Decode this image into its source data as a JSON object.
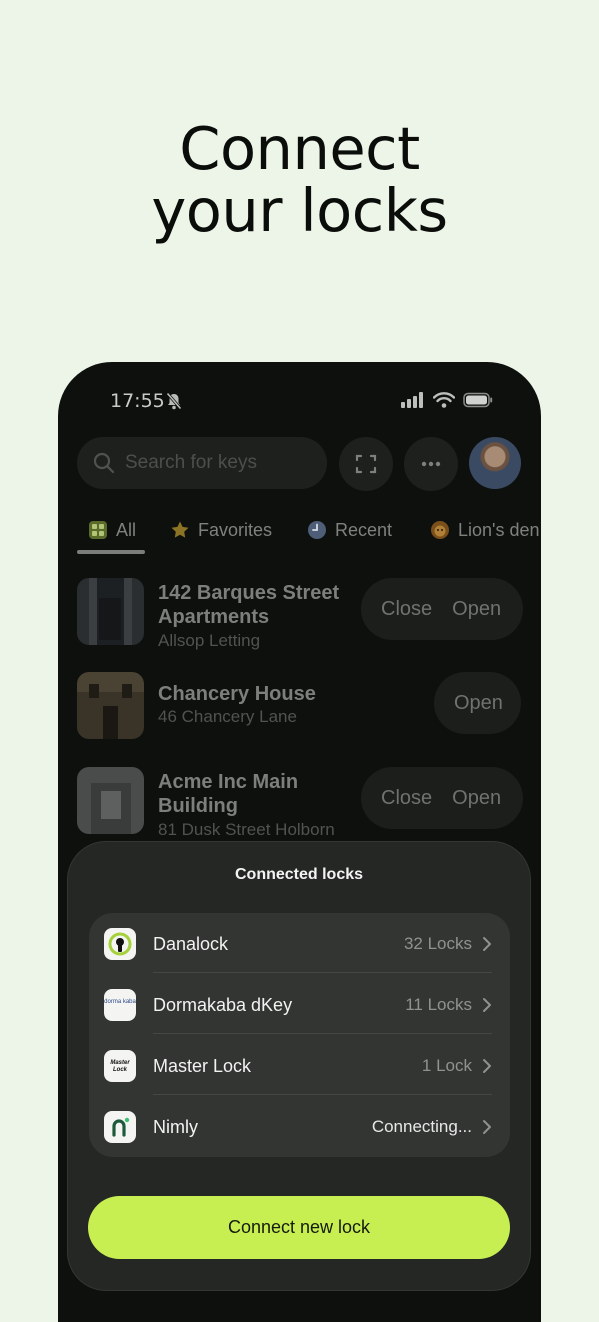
{
  "headline": {
    "line1": "Connect",
    "line2": "your locks"
  },
  "status_bar": {
    "time": "17:55"
  },
  "search": {
    "placeholder": "Search for keys"
  },
  "tabs": [
    {
      "label": "All",
      "icon": "grid-icon"
    },
    {
      "label": "Favorites",
      "icon": "star-icon"
    },
    {
      "label": "Recent",
      "icon": "clock-icon"
    },
    {
      "label": "Lion's den",
      "icon": "lion-icon"
    }
  ],
  "keys": [
    {
      "title_line1": "142 Barques Street",
      "title_line2": "Apartments",
      "subtitle": "Allsop Letting",
      "actions": [
        "Close",
        "Open"
      ]
    },
    {
      "title_line1": "Chancery House",
      "title_line2": "",
      "subtitle": "46 Chancery Lane",
      "actions": [
        "Open"
      ]
    },
    {
      "title_line1": "Acme Inc Main",
      "title_line2": "Building",
      "subtitle": "81 Dusk Street Holborn",
      "actions": [
        "Close",
        "Open"
      ]
    }
  ],
  "sheet": {
    "title": "Connected locks",
    "locks": [
      {
        "name": "Danalock",
        "count": "32 Locks",
        "logo": "danalock-logo"
      },
      {
        "name": "Dormakaba dKey",
        "count": "11 Locks",
        "logo": "dormakaba-logo"
      },
      {
        "name": "Master Lock",
        "count": "1 Lock",
        "logo": "masterlock-logo"
      },
      {
        "name": "Nimly",
        "count": "Connecting...",
        "logo": "nimly-logo"
      }
    ],
    "logo_texts": {
      "dormakaba": "dorma kaba",
      "masterlock": "Master Lock"
    },
    "connect_button": "Connect new lock"
  },
  "colors": {
    "accent": "#c8ef52",
    "background": "#ecf5e8",
    "phone": "#0e100e"
  }
}
